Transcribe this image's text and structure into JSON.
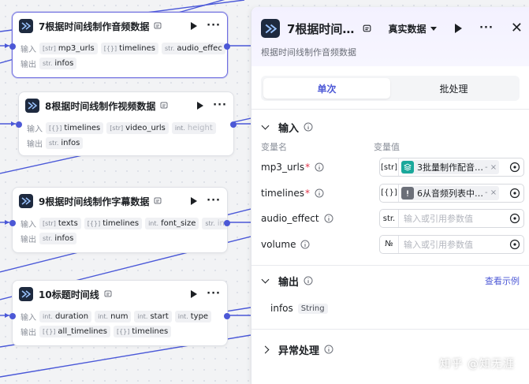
{
  "colors": {
    "accent": "#4c58d6",
    "selected_border": "#6f6ee0",
    "wire": "#4a58d8",
    "port": "#4c58d6"
  },
  "labels": {
    "input": "输入",
    "output": "输出"
  },
  "nodes": [
    {
      "title": "7根据时间线制作音频数据",
      "inputs": [
        {
          "type": "[str]",
          "name": "mp3_urls"
        },
        {
          "type": "[{}]",
          "name": "timelines"
        },
        {
          "type": "str.",
          "name": "audio_effec"
        }
      ],
      "outputs": [
        {
          "type": "str.",
          "name": "infos"
        }
      ],
      "selected": true
    },
    {
      "title": "8根据时间线制作视频数据",
      "inputs": [
        {
          "type": "[{}]",
          "name": "timelines"
        },
        {
          "type": "[str]",
          "name": "video_urls"
        },
        {
          "type": "int.",
          "name": "height"
        }
      ],
      "outputs": [
        {
          "type": "str.",
          "name": "infos"
        }
      ]
    },
    {
      "title": "9根据时间线制作字幕数据",
      "inputs": [
        {
          "type": "[str]",
          "name": "texts"
        },
        {
          "type": "[{}]",
          "name": "timelines"
        },
        {
          "type": "int.",
          "name": "font_size"
        },
        {
          "type": "str.",
          "name": "in"
        }
      ],
      "outputs": [
        {
          "type": "str.",
          "name": "infos"
        }
      ]
    },
    {
      "title": "10标题时间线",
      "inputs": [
        {
          "type": "int.",
          "name": "duration"
        },
        {
          "type": "int.",
          "name": "num"
        },
        {
          "type": "int.",
          "name": "start"
        },
        {
          "type": "int.",
          "name": "type"
        }
      ],
      "outputs": [
        {
          "type": "[{}]",
          "name": "all_timelines"
        },
        {
          "type": "[{}]",
          "name": "timelines"
        }
      ]
    }
  ],
  "panel": {
    "title": "7根据时间…",
    "mode": "真实数据",
    "description": "根据时间线制作音频数据",
    "tabs": [
      {
        "label": "单次",
        "active": true
      },
      {
        "label": "批处理",
        "active": false
      }
    ],
    "input_section": {
      "label": "输入",
      "col_name": "变量名",
      "col_value": "变量值",
      "rows": [
        {
          "name": "mp3_urls",
          "required": "*",
          "type": "[str]",
          "ref": "3批量制作配音…",
          "ref_tail": "- ×",
          "icon": "stack-icon"
        },
        {
          "name": "timelines",
          "required": "*",
          "type": "[{}]",
          "ref": "6从音频列表中…",
          "ref_tail": "- ×",
          "icon": "alert-icon"
        },
        {
          "name": "audio_effect",
          "required": "",
          "type": "str.",
          "placeholder": "输入或引用参数值"
        },
        {
          "name": "volume",
          "required": "",
          "type": "№",
          "placeholder": "输入或引用参数值"
        }
      ]
    },
    "output_section": {
      "label": "输出",
      "link": "查看示例",
      "rows": [
        {
          "name": "infos",
          "type": "String"
        }
      ]
    },
    "error_section": {
      "label": "异常处理"
    }
  },
  "watermark": "知乎 @知无涯"
}
